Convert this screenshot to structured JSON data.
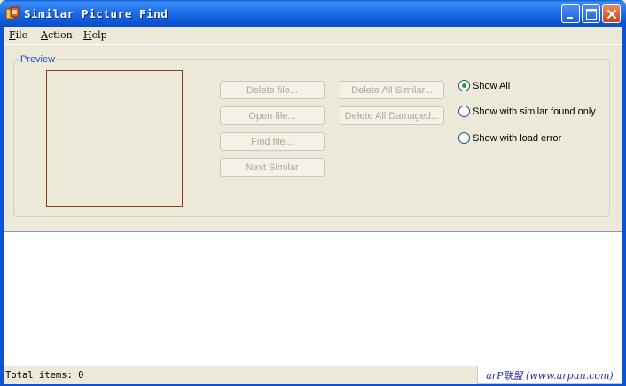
{
  "window": {
    "title": "Similar Picture Find"
  },
  "menu": {
    "items": [
      {
        "label_first": "F",
        "label_rest": "ile"
      },
      {
        "label_first": "A",
        "label_rest": "ction"
      },
      {
        "label_first": "H",
        "label_rest": "elp"
      }
    ]
  },
  "preview": {
    "group_label": "Preview"
  },
  "buttons": {
    "delete_file": "Delete file...",
    "open_file": "Open file...",
    "find_file": "Find file...",
    "next_similar": "Next Similar",
    "delete_all_similar": "Delete All Similar...",
    "delete_all_damaged": "Delete All Damaged..."
  },
  "filter": {
    "options": [
      {
        "label": "Show All",
        "selected": true
      },
      {
        "label": "Show with similar found only",
        "selected": false
      },
      {
        "label": "Show with load error",
        "selected": false
      }
    ]
  },
  "status": {
    "total_items": "Total items: 0",
    "watermark": "arP联盟 (www.arpun.com)"
  },
  "colors": {
    "titlebar": "#0B55D4",
    "face": "#ECE9D8",
    "group_label": "#2154CF",
    "preview_border": "#8A3A10",
    "disabled_text": "#ACA899",
    "radio_dot": "#21A121"
  },
  "icons": {
    "app": "picture-app-icon",
    "minimize": "minimize-icon",
    "maximize": "maximize-icon",
    "close": "close-icon"
  }
}
